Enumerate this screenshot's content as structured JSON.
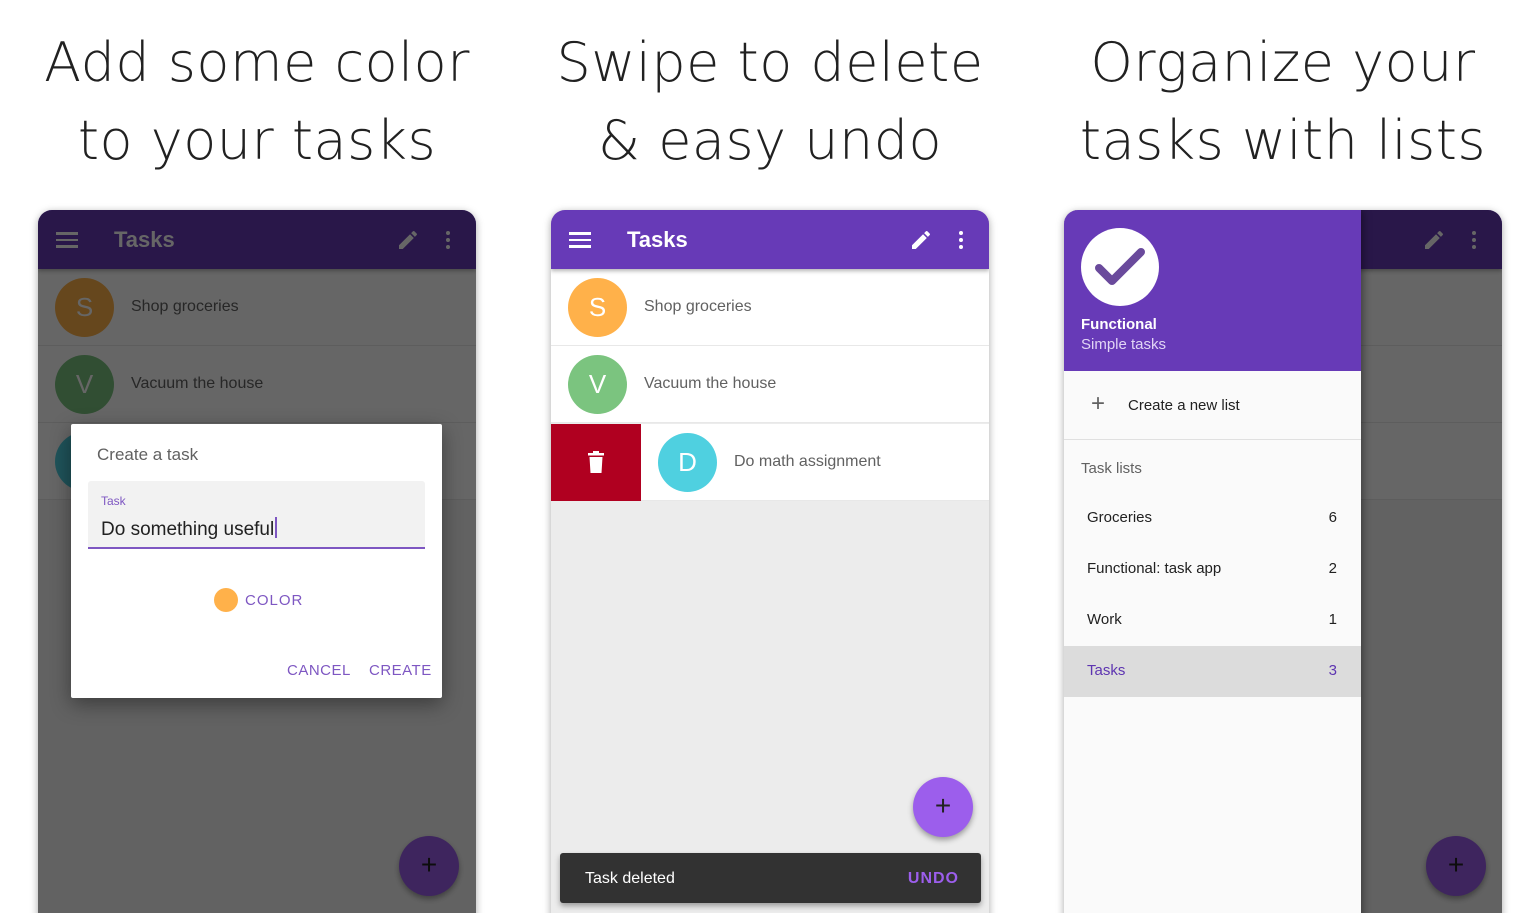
{
  "captions": [
    {
      "line1": "Add some color",
      "line2": "to your tasks"
    },
    {
      "line1": "Swipe to delete",
      "line2": "& easy undo"
    },
    {
      "line1": "Organize your",
      "line2": "tasks with lists"
    }
  ],
  "colors": {
    "primary": "#673ab7",
    "accent": "#9c5eec",
    "delete": "#b00020",
    "avatar_s": "#ffb14a",
    "avatar_v": "#7bc47f",
    "avatar_d": "#4fd0e0"
  },
  "appbar": {
    "title": "Tasks",
    "icons": [
      "menu-icon",
      "pencil-icon",
      "more-vert-icon"
    ]
  },
  "tasks": [
    {
      "letter": "S",
      "text": "Shop groceries"
    },
    {
      "letter": "V",
      "text": "Vacuum the house"
    },
    {
      "letter": "D",
      "text": "Do math assignment"
    }
  ],
  "dialog": {
    "title": "Create a task",
    "field_label": "Task",
    "field_value": "Do something useful",
    "color_label": "COLOR",
    "cancel": "CANCEL",
    "create": "CREATE"
  },
  "fab": {
    "label": "+"
  },
  "snackbar": {
    "message": "Task deleted",
    "action": "UNDO"
  },
  "drawer": {
    "app_name": "Functional",
    "app_subtitle": "Simple tasks",
    "create_label": "Create a new list",
    "plus": "+",
    "section_title": "Task lists",
    "lists": [
      {
        "name": "Groceries",
        "count": "6"
      },
      {
        "name": "Functional: task app",
        "count": "2"
      },
      {
        "name": "Work",
        "count": "1"
      },
      {
        "name": "Tasks",
        "count": "3"
      }
    ]
  }
}
